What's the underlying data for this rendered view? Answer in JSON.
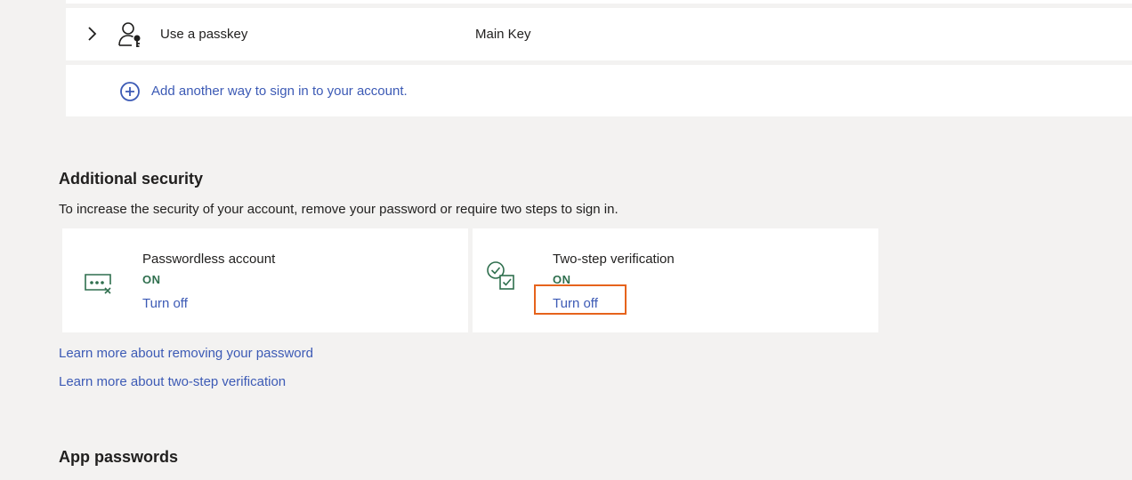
{
  "sign_in_methods": {
    "passkey": {
      "label": "Use a passkey",
      "value": "Main Key"
    },
    "add_link": "Add another way to sign in to your account."
  },
  "additional_security": {
    "title": "Additional security",
    "description": "To increase the security of your account, remove your password or require two steps to sign in.",
    "passwordless": {
      "title": "Passwordless account",
      "status": "ON",
      "action": "Turn off"
    },
    "two_step": {
      "title": "Two-step verification",
      "status": "ON",
      "action": "Turn off"
    },
    "learn_remove_password": "Learn more about removing your password",
    "learn_two_step": "Learn more about two-step verification"
  },
  "app_passwords": {
    "title": "App passwords"
  },
  "colors": {
    "link": "#3c5ab5",
    "status_on": "#2f6f4e",
    "highlight": "#e6631c",
    "background": "#f3f2f1"
  },
  "icons": [
    "chevron-right-icon",
    "passkey-person-icon",
    "plus-circle-icon",
    "password-dots-x-icon",
    "two-step-check-icon"
  ]
}
